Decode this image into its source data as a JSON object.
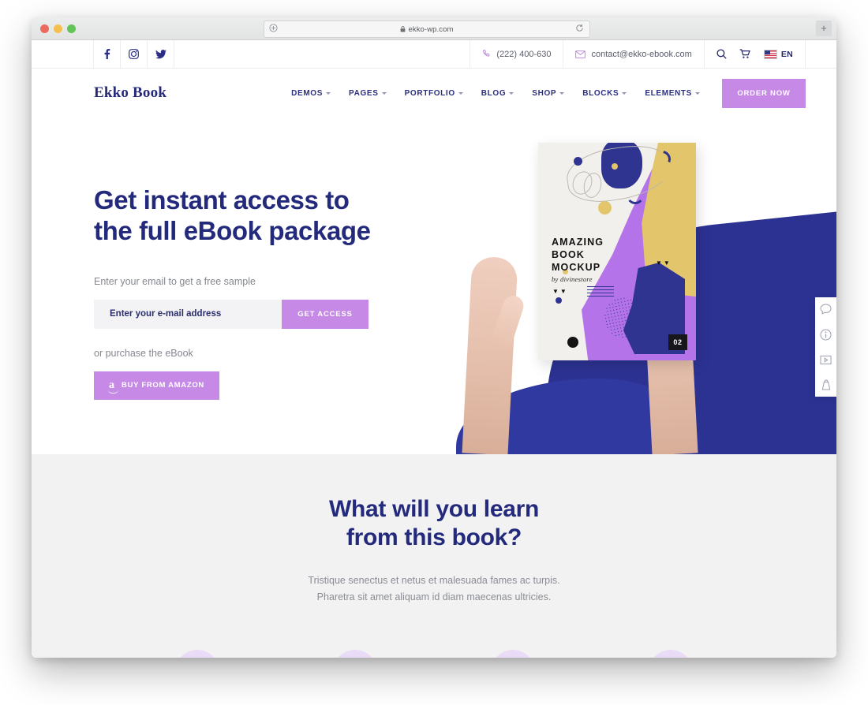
{
  "browser": {
    "url": "ekko-wp.com",
    "lock_icon": "lock-icon",
    "reload_icon": "reload-icon",
    "new_tab_label": "+"
  },
  "topbar": {
    "social": [
      {
        "name": "facebook-icon",
        "label": "f"
      },
      {
        "name": "instagram-icon",
        "label": ""
      },
      {
        "name": "twitter-icon",
        "label": ""
      }
    ],
    "phone": "(222) 400-630",
    "email": "contact@ekko-ebook.com",
    "search_icon": "search-icon",
    "cart_icon": "cart-icon",
    "language": "EN"
  },
  "nav": {
    "brand": "Ekko Book",
    "items": [
      {
        "label": "DEMOS",
        "has_submenu": true
      },
      {
        "label": "PAGES",
        "has_submenu": true
      },
      {
        "label": "PORTFOLIO",
        "has_submenu": true
      },
      {
        "label": "BLOG",
        "has_submenu": true
      },
      {
        "label": "SHOP",
        "has_submenu": true
      },
      {
        "label": "BLOCKS",
        "has_submenu": true
      },
      {
        "label": "ELEMENTS",
        "has_submenu": true
      }
    ],
    "cta_label": "ORDER NOW"
  },
  "hero": {
    "title_line1": "Get instant access to",
    "title_line2": "the full eBook package",
    "subtitle": "Enter your email to get a free sample",
    "email_placeholder": "Enter your e-mail address",
    "email_value": "",
    "submit_label": "GET ACCESS",
    "purchase_text": "or purchase the eBook",
    "amazon_label": "BUY FROM AMAZON",
    "amazon_icon": "amazon-icon",
    "book": {
      "title_line1": "AMAZING",
      "title_line2": "BOOK",
      "title_line3": "MOCKUP",
      "author": "by divinestore",
      "badge": "02",
      "chevrons": "▼▼"
    }
  },
  "side_toolbar": {
    "items": [
      {
        "name": "chat-bubble-icon"
      },
      {
        "name": "info-icon"
      },
      {
        "name": "video-play-icon"
      },
      {
        "name": "shopping-bag-icon"
      }
    ]
  },
  "learn": {
    "title_line1": "What will you learn",
    "title_line2": "from this book?",
    "sub_line1": "Tristique senectus et netus et malesuada fames ac turpis.",
    "sub_line2": "Pharetra sit amet aliquam id diam maecenas ultricies.",
    "circle_count": 4
  },
  "colors": {
    "navy": "#232a7c",
    "purple_accent": "#c68ae6",
    "book_purple": "#b473e8",
    "book_yellow": "#e3c56b",
    "book_navy": "#2f3490",
    "section_bg": "#f2f2f3",
    "muted_text": "#84878f"
  }
}
